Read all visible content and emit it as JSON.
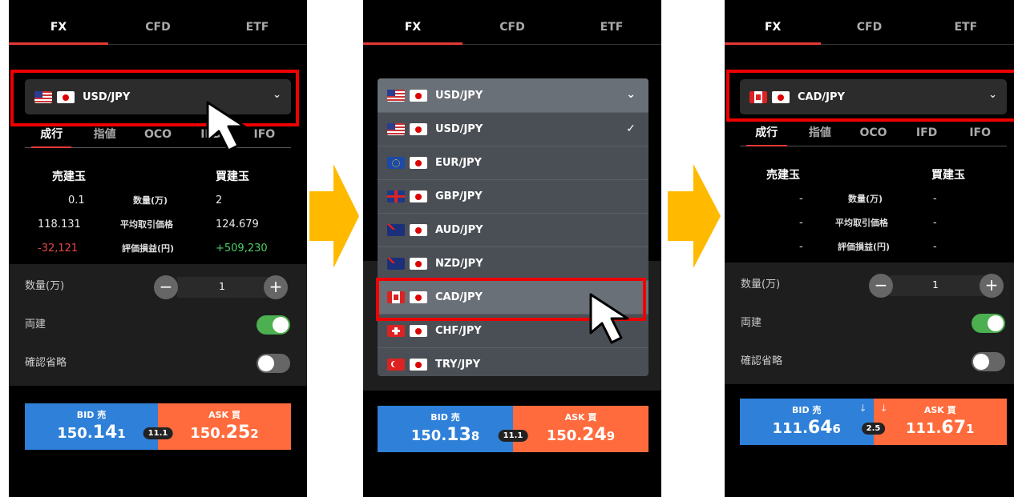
{
  "tabs": [
    "FX",
    "CFD",
    "ETF"
  ],
  "order_tabs": [
    "成行",
    "指値",
    "OCO",
    "IFD",
    "IFO"
  ],
  "position_headers": {
    "sell": "売建玉",
    "buy": "買建玉"
  },
  "row_labels": [
    "数量(万)",
    "平均取引価格",
    "評価損益(円)"
  ],
  "settings": {
    "qty_label": "数量(万)",
    "qty_value": "1",
    "hedge_label": "両建",
    "skip_confirm_label": "確認省略",
    "minus": "−",
    "plus": "+"
  },
  "panel1": {
    "pair": "USD/JPY",
    "flags": [
      "flag-us",
      "flag-jp"
    ],
    "sell": [
      "0.1",
      "118.131",
      "-32,121"
    ],
    "buy": [
      "2",
      "124.679",
      "+509,230"
    ],
    "bid_label": "BID 売",
    "bid_price": {
      "a": "150.",
      "b": "14",
      "c": "1"
    },
    "spread": "11.1",
    "ask_label": "ASK 買",
    "ask_price": {
      "a": "150.",
      "b": "25",
      "c": "2"
    }
  },
  "panel2": {
    "header_pair": "USD/JPY",
    "items": [
      {
        "pair": "USD/JPY",
        "flag": "flag-us",
        "check": "✓"
      },
      {
        "pair": "EUR/JPY",
        "flag": "flag-eu",
        "check": ""
      },
      {
        "pair": "GBP/JPY",
        "flag": "flag-gb",
        "check": ""
      },
      {
        "pair": "AUD/JPY",
        "flag": "flag-au",
        "check": ""
      },
      {
        "pair": "NZD/JPY",
        "flag": "flag-nz",
        "check": ""
      },
      {
        "pair": "CAD/JPY",
        "flag": "flag-ca",
        "check": ""
      },
      {
        "pair": "CHF/JPY",
        "flag": "flag-ch",
        "check": ""
      },
      {
        "pair": "TRY/JPY",
        "flag": "flag-tr",
        "check": ""
      }
    ],
    "bid_label": "BID 売",
    "bid_price": {
      "a": "150.",
      "b": "13",
      "c": "8"
    },
    "spread": "11.1",
    "ask_label": "ASK 買",
    "ask_price": {
      "a": "150.",
      "b": "24",
      "c": "9"
    }
  },
  "panel3": {
    "pair": "CAD/JPY",
    "flags": [
      "flag-ca",
      "flag-jp"
    ],
    "sell": [
      "-",
      "-",
      "-"
    ],
    "buy": [
      "-",
      "-",
      "-"
    ],
    "bid_label": "BID 売",
    "bid_arrow": "↓",
    "bid_price": {
      "a": "111.",
      "b": "64",
      "c": "6"
    },
    "spread": "2.5",
    "ask_label": "ASK 買",
    "ask_arrow": "↓",
    "ask_price": {
      "a": "111.",
      "b": "67",
      "c": "1"
    }
  },
  "colors": {
    "accent_red": "#e53935",
    "bid_blue": "#2f80d8",
    "ask_orange": "#ff6b3d",
    "toggle_on": "#4caf50",
    "arrow_yellow": "#ffba00",
    "loss": "#e84545",
    "gain": "#4ccf6a"
  }
}
